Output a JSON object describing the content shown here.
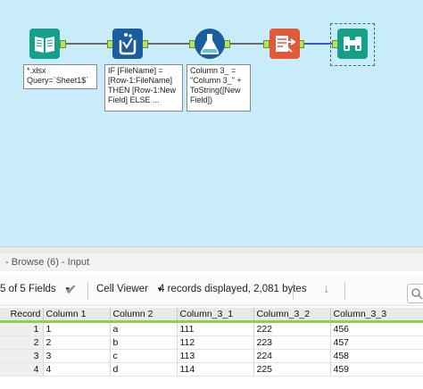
{
  "workflow": {
    "nodes": [
      {
        "name": "input-data-tool",
        "icon": "book-icon",
        "color": "#15a08a"
      },
      {
        "name": "multi-row-formula-tool",
        "icon": "multi-row-formula-icon",
        "color": "#1b5e9e"
      },
      {
        "name": "formula-tool",
        "icon": "flask-icon",
        "color": "#1b5e9e"
      },
      {
        "name": "select-tool",
        "icon": "select-records-icon",
        "color": "#e05a3a"
      },
      {
        "name": "browse-tool",
        "icon": "binoculars-icon",
        "color": "#15a08a"
      }
    ],
    "annotations": {
      "input": "*.xlsx\nQuery=`Sheet1$`",
      "multirow": "IF [FileName] =\n[Row-1:FileName]\nTHEN [Row-1:New\nField] ELSE ...",
      "formula": "Column 3_ =\n\"Column 3_\" +\nToString([New\nField])"
    }
  },
  "results": {
    "header": "- Browse (6) - Input",
    "fields_label": "5 of 5 Fields",
    "viewer_label": "Cell Viewer",
    "records_info": "4 records displayed, 2,081 bytes"
  },
  "table": {
    "columns": [
      "Record",
      "Column 1",
      "Column 2",
      "Column_3_1",
      "Column_3_2",
      "Column_3_3"
    ],
    "rows": [
      [
        "1",
        "1",
        "a",
        "111",
        "222",
        "456"
      ],
      [
        "2",
        "2",
        "b",
        "112",
        "223",
        "457"
      ],
      [
        "3",
        "3",
        "c",
        "113",
        "224",
        "458"
      ],
      [
        "4",
        "4",
        "d",
        "114",
        "225",
        "459"
      ]
    ]
  }
}
